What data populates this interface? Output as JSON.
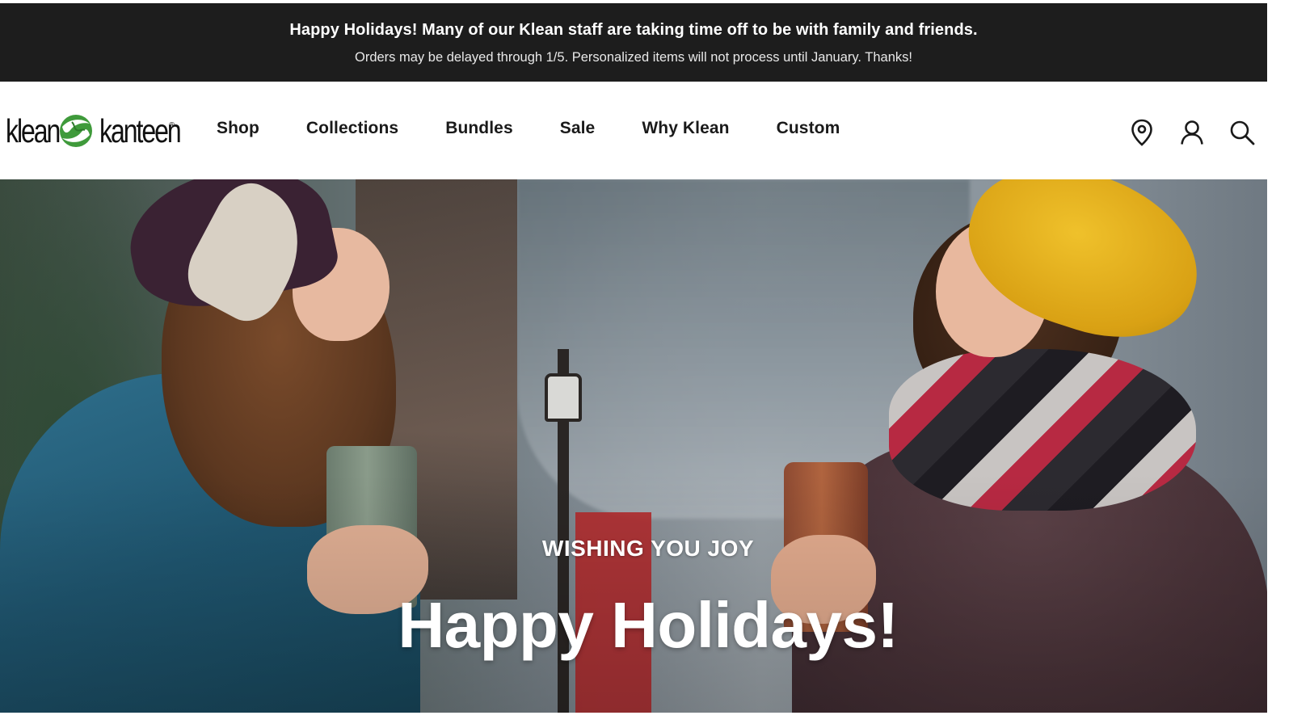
{
  "announcement": {
    "line1": "Happy Holidays! Many of our Klean staff are taking time off to be with family and friends.",
    "line2": "Orders may be delayed through 1/5. Personalized items will not process until January. Thanks!"
  },
  "header": {
    "logo": {
      "word1": "klean",
      "word2": "kanteen",
      "registered": "®"
    },
    "nav": [
      {
        "label": "Shop"
      },
      {
        "label": "Collections"
      },
      {
        "label": "Bundles"
      },
      {
        "label": "Sale"
      },
      {
        "label": "Why Klean"
      },
      {
        "label": "Custom"
      }
    ],
    "icons": [
      "location-pin-icon",
      "account-icon",
      "search-icon"
    ]
  },
  "hero": {
    "kicker": "WISHING YOU JOY",
    "headline": "Happy Holidays!"
  },
  "colors": {
    "announcement_bg": "#1d1d1d",
    "text_dark": "#1a1a1a",
    "logo_green": "#3f9a3b"
  }
}
